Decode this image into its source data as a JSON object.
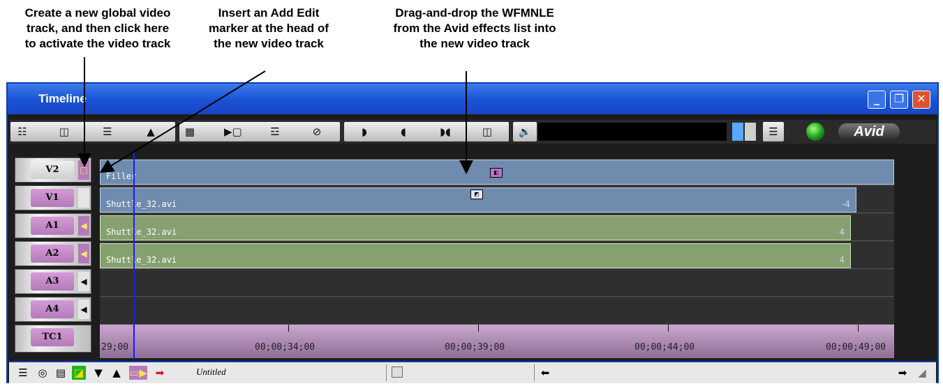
{
  "callouts": [
    "Create a new global video\ntrack, and then click here\nto activate the video track",
    "Insert an Add Edit\nmarker at the head of\nthe new video track",
    "Drag-and-drop the WFMNLE\nfrom the Avid effects list into\nthe new video track"
  ],
  "window": {
    "title": "Timeline",
    "min_label": "_",
    "max_label": "❐",
    "close_label": "✕"
  },
  "toolbar": {
    "tools": [
      "track-settings-icon",
      "window-icon",
      "ruler-icon",
      "eject-icon",
      "film-frame-icon",
      "segment-in-icon",
      "lift-icon",
      "no-entry-icon",
      "mark-in-icon",
      "mark-out-icon",
      "mark-clip-icon",
      "split-icon",
      "speaker-icon"
    ],
    "logo": "Avid",
    "accent": "#1a52d6"
  },
  "tracks": [
    {
      "name": "V2",
      "indicator": "□",
      "active": false
    },
    {
      "name": "V1",
      "indicator": "",
      "active": true
    },
    {
      "name": "A1",
      "indicator": "◀",
      "active": true
    },
    {
      "name": "A2",
      "indicator": "◀",
      "active": true
    },
    {
      "name": "A3",
      "indicator": "◀",
      "active": true
    },
    {
      "name": "A4",
      "indicator": "◀",
      "active": true
    },
    {
      "name": "TC1",
      "indicator": "",
      "active": true
    }
  ],
  "clips": {
    "v2": "Filler",
    "v1": "Shuttle_32.avi",
    "a1": "Shuttle_32.avi",
    "a2": "Shuttle_32.avi",
    "v1_end": "-4",
    "a1_end": "4",
    "a2_end": "4"
  },
  "timecodes": [
    "29;00",
    "00;00;34;00",
    "00;00;39;00",
    "00;00;44;00",
    "00;00;49;00"
  ],
  "bottombar": {
    "sequence_name": "Untitled"
  }
}
